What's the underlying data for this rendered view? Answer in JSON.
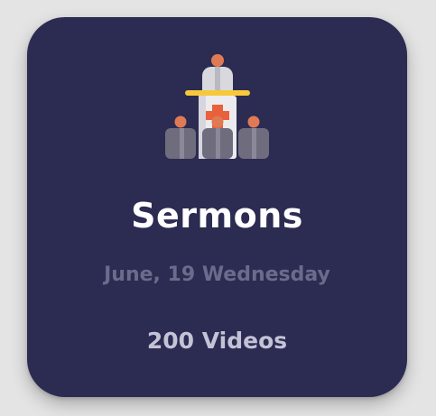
{
  "card": {
    "icon": "church-pulpit-icon",
    "title": "Sermons",
    "date": "June, 19 Wednesday",
    "count": "200 Videos"
  },
  "colors": {
    "card_background": "#2c2b52",
    "title": "#ffffff",
    "date": "#6b6b8c",
    "count": "#c4c3d6",
    "accent_cross": "#e8603c",
    "accent_halo": "#f7c83a"
  }
}
